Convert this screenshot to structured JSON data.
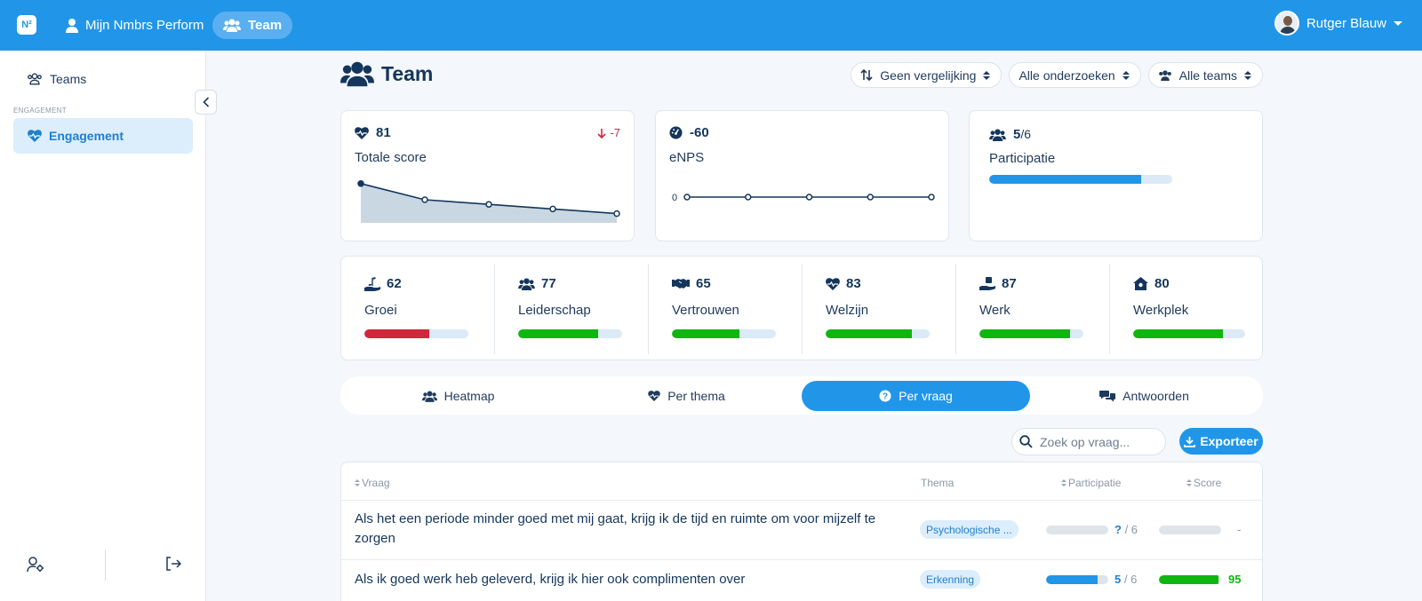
{
  "topbar": {
    "logo": "N²",
    "nav": [
      {
        "label": "Mijn Nmbrs Perform",
        "icon": "user-icon"
      },
      {
        "label": "Team",
        "icon": "users-icon",
        "active": true
      }
    ],
    "user_name": "Rutger Blauw"
  },
  "sidebar": {
    "teams_label": "Teams",
    "section_label": "ENGAGEMENT",
    "active_label": "Engagement"
  },
  "page": {
    "title": "Team",
    "filters": [
      {
        "label": "Geen vergelijking",
        "icon": "sort-arrows-icon"
      },
      {
        "label": "Alle onderzoeken"
      },
      {
        "label": "Alle teams",
        "icon": "users-icon"
      }
    ]
  },
  "kpis": {
    "total": {
      "value": "81",
      "label": "Totale score",
      "delta": "-7",
      "series": [
        92,
        85,
        83,
        81,
        79
      ]
    },
    "enps": {
      "value": "-60",
      "label": "eNPS",
      "axis_label": "0",
      "series": [
        0,
        0,
        0,
        0,
        0
      ]
    },
    "participation": {
      "value": "5",
      "total": "/6",
      "label": "Participatie",
      "fraction": 0.83
    }
  },
  "themes": [
    {
      "value": "62",
      "label": "Groei",
      "fraction": 0.62,
      "color": "#d1273b",
      "icon": "growth-icon"
    },
    {
      "value": "77",
      "label": "Leiderschap",
      "fraction": 0.77,
      "color": "#0fb60f",
      "icon": "users-icon"
    },
    {
      "value": "65",
      "label": "Vertrouwen",
      "fraction": 0.65,
      "color": "#0fb60f",
      "icon": "handshake-icon"
    },
    {
      "value": "83",
      "label": "Welzijn",
      "fraction": 0.83,
      "color": "#0fb60f",
      "icon": "heart-pulse-icon"
    },
    {
      "value": "87",
      "label": "Werk",
      "fraction": 0.87,
      "color": "#0fb60f",
      "icon": "hand-work-icon"
    },
    {
      "value": "80",
      "label": "Werkplek",
      "fraction": 0.8,
      "color": "#0fb60f",
      "icon": "house-icon"
    }
  ],
  "tabs": [
    {
      "label": "Heatmap",
      "icon": "users-icon"
    },
    {
      "label": "Per thema",
      "icon": "heart-pulse-icon"
    },
    {
      "label": "Per vraag",
      "icon": "question-icon",
      "active": true
    },
    {
      "label": "Antwoorden",
      "icon": "comments-icon"
    }
  ],
  "toolbar": {
    "search_placeholder": "Zoek op vraag...",
    "export_label": "Exporteer"
  },
  "table": {
    "headers": {
      "question": "Vraag",
      "theme": "Thema",
      "participation": "Participatie",
      "score": "Score"
    },
    "rows": [
      {
        "question": "Als het een periode minder goed met mij gaat, krijg ik de tijd en ruimte om voor mijzelf te zorgen",
        "theme": "Psychologische ...",
        "part_value": "?",
        "part_total": " / 6",
        "part_fraction": 0,
        "score": "-",
        "score_fraction": 0,
        "score_color": "#8a98a8"
      },
      {
        "question": "Als ik goed werk heb geleverd, krijg ik hier ook complimenten over",
        "theme": "Erkenning",
        "part_value": "5",
        "part_total": " / 6",
        "part_fraction": 0.83,
        "score": "95",
        "score_fraction": 0.95,
        "score_color": "#0fb60f"
      }
    ]
  },
  "colors": {
    "primary": "#2196e8",
    "success": "#0fb60f",
    "danger": "#d1273b",
    "track": "#dbeaf6"
  }
}
